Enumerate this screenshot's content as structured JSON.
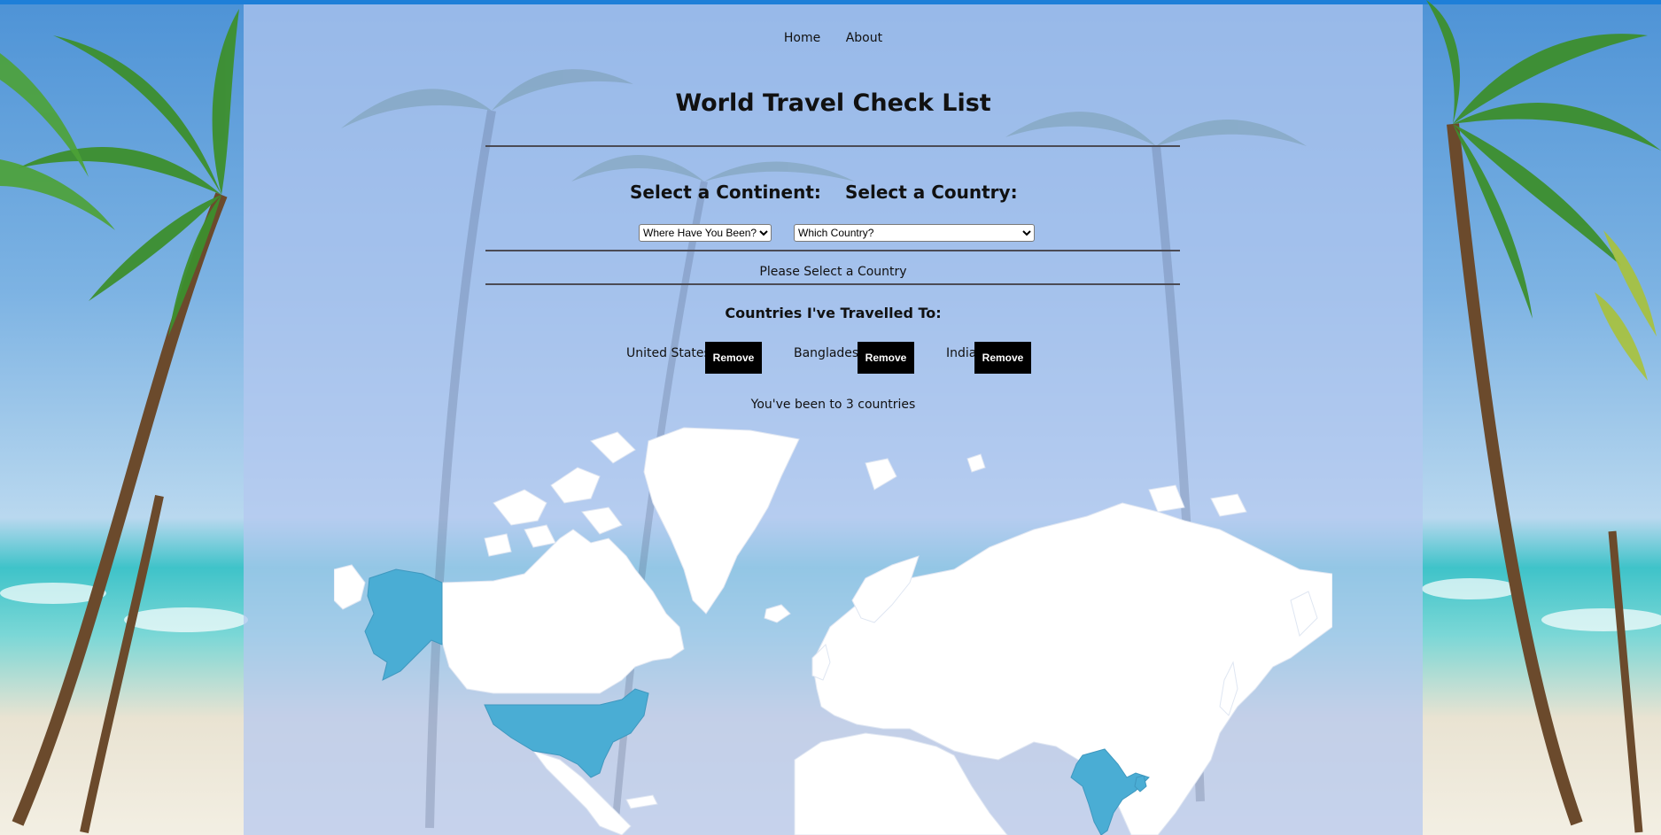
{
  "nav": {
    "home": "Home",
    "about": "About"
  },
  "page": {
    "title": "World Travel Check List"
  },
  "selectors": {
    "continent_label": "Select a Continent:",
    "country_label": "Select a Country:",
    "continent_value": "Where Have You Been?",
    "country_value": "Which Country?"
  },
  "message": "Please Select a Country",
  "travelled": {
    "heading": "Countries I've Travelled To:",
    "countries": [
      {
        "name": "United States",
        "button": "Remove"
      },
      {
        "name": "Bangladesh",
        "button": "Remove"
      },
      {
        "name": "India",
        "button": "Remove"
      }
    ],
    "count_text": "You've been to 3 countries"
  },
  "map": {
    "visited_color": "#4aadd4",
    "land_color": "#ffffff"
  }
}
